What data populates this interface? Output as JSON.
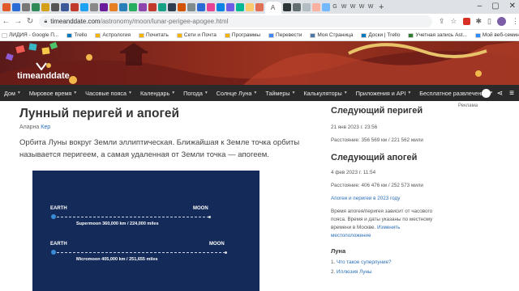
{
  "browser": {
    "url_host": "timeanddate.com",
    "url_path": "/astronomy/moon/lunar-perigee-apogee.html",
    "new_tab": "+",
    "tab_colors": [
      "#e05a2b",
      "#2b6bd6",
      "#777",
      "#2e8b57",
      "#d4a017",
      "#555",
      "#3b5998",
      "#c0392b",
      "#1da1f2",
      "#888",
      "#6a1b9a",
      "#e67e22",
      "#2980b9",
      "#27ae60",
      "#8e44ad",
      "#c0392b",
      "#16a085",
      "#2c3e50",
      "#d35400",
      "#7f8c8d",
      "#2b6bd6",
      "#e84393",
      "#0984e3",
      "#6c5ce7",
      "#00b894",
      "#fdcb6e",
      "#e17055",
      "#2d3436",
      "#636e72",
      "#b2bec3",
      "#fab1a0",
      "#74b9ff"
    ],
    "active_tab_letter": "A",
    "tail_tabs": [
      "G",
      "W",
      "W",
      "W",
      "W"
    ]
  },
  "bookmarks": [
    {
      "label": "ЛИДИЯ - Google П...",
      "color": "#ffffff"
    },
    {
      "label": "Trello",
      "color": "#0079bf"
    },
    {
      "label": "Астрология",
      "color": "#f4b400"
    },
    {
      "label": "Почитать",
      "color": "#f4b400"
    },
    {
      "label": "Сети и Почта",
      "color": "#f4b400"
    },
    {
      "label": "Программы",
      "color": "#f4b400"
    },
    {
      "label": "Перевести",
      "color": "#4285f4"
    },
    {
      "label": "Моя Страница",
      "color": "#4a76a8"
    },
    {
      "label": "Доски | Trello",
      "color": "#0079bf"
    },
    {
      "label": "Учетная запись Ast...",
      "color": "#2e7d32"
    },
    {
      "label": "Мой веб-семинар",
      "color": "#2d8cff"
    }
  ],
  "site": {
    "logo": "timeanddate",
    "nav": [
      {
        "label": "Дом",
        "caret": true
      },
      {
        "label": "Мировое время",
        "caret": true
      },
      {
        "label": "Часовые пояса",
        "caret": true
      },
      {
        "label": "Календарь",
        "caret": true
      },
      {
        "label": "Погода",
        "caret": true
      },
      {
        "label": "Солнце Луна",
        "caret": true
      },
      {
        "label": "Таймеры",
        "caret": true
      },
      {
        "label": "Калькуляторы",
        "caret": true
      },
      {
        "label": "Приложения и API",
        "caret": true
      },
      {
        "label": "Бесплатное развлечение",
        "caret": true
      }
    ]
  },
  "article": {
    "title": "Лунный перигей и апогей",
    "author_prefix": "Аларна",
    "author_name": "Кер",
    "lead": "Орбита Луны вокруг Земли эллиптическая. Ближайшая к Земле точка орбиты называется перигеем, а самая удаленная от Земли точка — апогеем."
  },
  "diagram": {
    "earth_label": "EARTH",
    "moon_label": "MOON",
    "supermoon": "Supermoon 360,000 km / 224,000 miles",
    "micromoon": "Micromoon 405,000 km / 251,655 miles",
    "bg": "#142a58"
  },
  "sidebar": {
    "ad": "Реклама",
    "perigee_title": "Следующий перигей",
    "perigee_date": "21 янв 2023 г. 23:56",
    "perigee_dist": "Расстояние: 356 569 км / 221 562 мили",
    "apogee_title": "Следующий апогей",
    "apogee_date": "4 фев 2023 г. 11:54",
    "apogee_dist": "Расстояние: 406 476 км / 252 573 мили",
    "year_link": "Апогеи и перигеи в 2023 году",
    "tz_note_1": "Время апогея/перигея зависит от часового",
    "tz_note_2": "пояса. Время и даты указаны по местному",
    "tz_note_3_a": "времени в Москве.",
    "tz_note_3_link": "Изменить",
    "tz_note_4": "местоположение",
    "moon_heading": "Луна",
    "moon_links": [
      {
        "num": "1.",
        "label": "Что такое суперлуние?"
      },
      {
        "num": "2.",
        "label": "Иллюзия Луны"
      }
    ]
  }
}
